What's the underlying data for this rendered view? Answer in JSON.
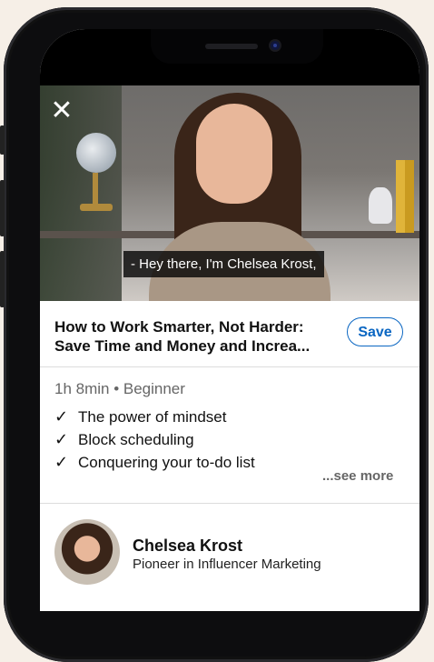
{
  "video": {
    "close_icon": "close-icon",
    "caption": "- Hey there, I'm Chelsea Krost,"
  },
  "course": {
    "title_line1": "How to Work Smarter, Not Harder:",
    "title_line2": "Save Time and Money and Increa...",
    "save_label": "Save",
    "meta": "1h 8min • Beginner",
    "learnings": [
      "The power of mindset",
      "Block scheduling",
      "Conquering your to-do list"
    ],
    "see_more": "...see more"
  },
  "instructor": {
    "name": "Chelsea Krost",
    "title": "Pioneer in Influencer Marketing"
  },
  "colors": {
    "accent": "#0a66c2",
    "background": "#f6efe7"
  }
}
